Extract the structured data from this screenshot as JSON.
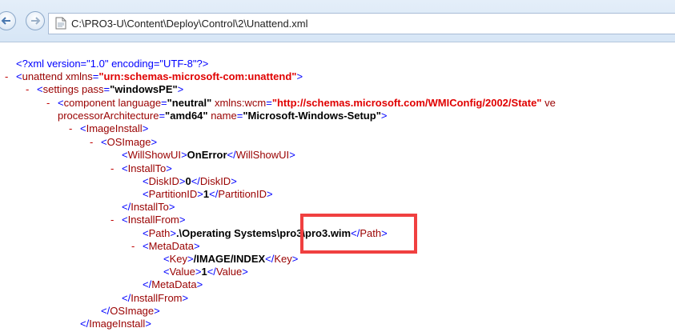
{
  "address": {
    "url": "C:\\PRO3-U\\Content\\Deploy\\Control\\2\\Unattend.xml"
  },
  "xml": {
    "declaration": "<?xml version=\"1.0\" encoding=\"UTF-8\"?>",
    "toggle": "-",
    "lt": "<",
    "gt": ">",
    "lt_slash": "</",
    "eq": "=",
    "unattend": {
      "tag": "unattend",
      "attr": "xmlns",
      "value": "\"urn:schemas-microsoft-com:unattend\""
    },
    "settings": {
      "tag": "settings",
      "attr": "pass",
      "value": "\"windowsPE\""
    },
    "component": {
      "tag": "component",
      "attr1": "language",
      "value1": "\"neutral\"",
      "attr2": "xmlns:wcm",
      "value2": "\"http://schemas.microsoft.com/WMIConfig/2002/State\"",
      "attr3_cut": "ve",
      "attr4": "processorArchitecture",
      "value4": "\"amd64\"",
      "attr5": "name",
      "value5": "\"Microsoft-Windows-Setup\""
    },
    "image_install": {
      "tag": "ImageInstall"
    },
    "os_image": {
      "tag": "OSImage"
    },
    "will_show_ui": {
      "tag": "WillShowUI",
      "value": "OnError"
    },
    "install_to": {
      "tag": "InstallTo"
    },
    "disk_id": {
      "tag": "DiskID",
      "value": "0"
    },
    "partition_id": {
      "tag": "PartitionID",
      "value": "1"
    },
    "install_from": {
      "tag": "InstallFrom"
    },
    "path": {
      "tag": "Path",
      "value": ".\\Operating Systems\\pro3\\pro3.wim"
    },
    "meta_data": {
      "tag": "MetaData"
    },
    "key": {
      "tag": "Key",
      "value": "/IMAGE/INDEX"
    },
    "value_el": {
      "tag": "Value",
      "value": "1"
    }
  },
  "colors": {
    "markup": "#c00000",
    "tag": "#990000",
    "processing": "#0000ff",
    "uri_value": "#e00000",
    "highlight": "#f04040"
  }
}
